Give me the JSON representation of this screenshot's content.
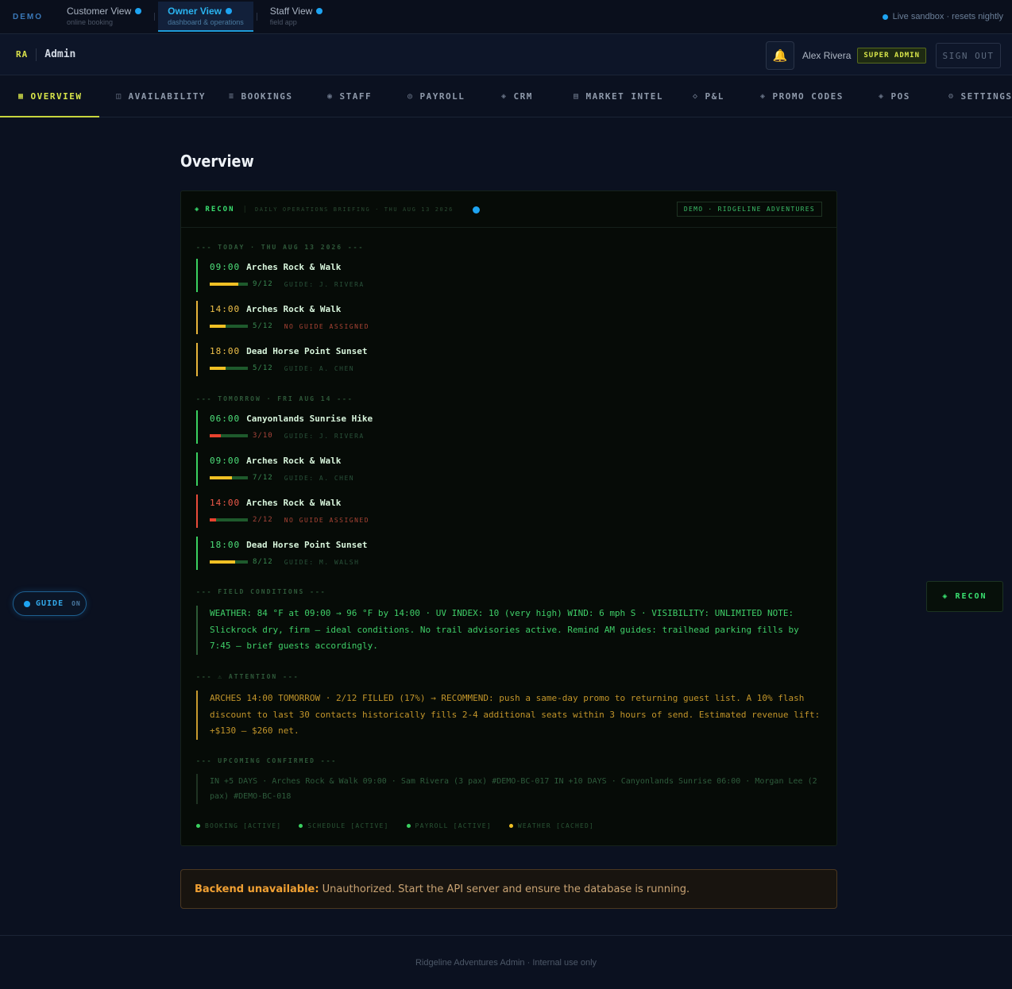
{
  "demo_bar": {
    "tag": "DEMO",
    "views": [
      {
        "title": "Customer View",
        "subtitle": "online booking"
      },
      {
        "title": "Owner View",
        "subtitle": "dashboard & operations"
      },
      {
        "title": "Staff View",
        "subtitle": "field app"
      }
    ],
    "live_status": "Live sandbox · resets nightly"
  },
  "header": {
    "initials": "RA",
    "section": "Admin",
    "bell_icon": "🔔",
    "user_name": "Alex Rivera",
    "role_badge": "SUPER ADMIN",
    "sign_out": "SIGN OUT"
  },
  "nav": [
    {
      "icon": "▦",
      "label": "OVERVIEW"
    },
    {
      "icon": "◫",
      "label": "AVAILABILITY"
    },
    {
      "icon": "≡",
      "label": "BOOKINGS"
    },
    {
      "icon": "◉",
      "label": "STAFF"
    },
    {
      "icon": "◎",
      "label": "PAYROLL"
    },
    {
      "icon": "◈",
      "label": "CRM"
    },
    {
      "icon": "▤",
      "label": "MARKET INTEL"
    },
    {
      "icon": "◇",
      "label": "P&L"
    },
    {
      "icon": "◈",
      "label": "PROMO CODES"
    },
    {
      "icon": "◈",
      "label": "POS"
    },
    {
      "icon": "⚙",
      "label": "SETTINGS"
    }
  ],
  "page_title": "Overview",
  "recon": {
    "icon": "◈",
    "title": "RECON",
    "separator": "|",
    "subtitle": "DAILY OPERATIONS BRIEFING · THU AUG 13 2026",
    "demo_badge": "DEMO · RIDGELINE ADVENTURES",
    "today_header": "--- TODAY · THU AUG 13 2026 ---",
    "today": [
      {
        "time": "09:00",
        "name": "Arches Rock & Walk",
        "capacity": "9/12",
        "fill": 0.75,
        "guide": "GUIDE: J. RIVERA",
        "status": "green"
      },
      {
        "time": "14:00",
        "name": "Arches Rock & Walk",
        "capacity": "5/12",
        "fill": 0.42,
        "guide": "NO GUIDE ASSIGNED",
        "status": "amber"
      },
      {
        "time": "18:00",
        "name": "Dead Horse Point Sunset",
        "capacity": "5/12",
        "fill": 0.42,
        "guide": "GUIDE: A. CHEN",
        "status": "amber"
      }
    ],
    "tomorrow_header": "--- TOMORROW · FRI AUG 14 ---",
    "tomorrow": [
      {
        "time": "06:00",
        "name": "Canyonlands Sunrise Hike",
        "capacity": "3/10",
        "fill": 0.3,
        "guide": "GUIDE: J. RIVERA",
        "status": "green"
      },
      {
        "time": "09:00",
        "name": "Arches Rock & Walk",
        "capacity": "7/12",
        "fill": 0.58,
        "guide": "GUIDE: A. CHEN",
        "status": "green"
      },
      {
        "time": "14:00",
        "name": "Arches Rock & Walk",
        "capacity": "2/12",
        "fill": 0.17,
        "guide": "NO GUIDE ASSIGNED",
        "status": "red"
      },
      {
        "time": "18:00",
        "name": "Dead Horse Point Sunset",
        "capacity": "8/12",
        "fill": 0.67,
        "guide": "GUIDE: M. WALSH",
        "status": "green"
      }
    ],
    "field_header": "--- FIELD CONDITIONS ---",
    "field_text": "WEATHER: 84 °F at 09:00 → 96 °F by 14:00 · UV INDEX: 10 (very high) WIND: 6 mph S · VISIBILITY: UNLIMITED NOTE: Slickrock dry, firm — ideal conditions. No trail advisories active. Remind AM guides: trailhead parking fills by 7:45 — brief guests accordingly.",
    "attention_header": "--- ⚠ ATTENTION ---",
    "attention_text": "ARCHES 14:00 TOMORROW · 2/12 FILLED (17%) → RECOMMEND: push a same-day promo to returning guest list. A 10% flash discount to last 30 contacts historically fills 2-4 additional seats within 3 hours of send. Estimated revenue lift: +$130 – $260 net.",
    "upcoming_header": "--- UPCOMING CONFIRMED ---",
    "upcoming_text": "IN +5 DAYS · Arches Rock & Walk 09:00 · Sam Rivera (3 pax) #DEMO-BC-017 IN +10 DAYS · Canyonlands Sunrise 06:00 · Morgan Lee (2 pax) #DEMO-BC-018",
    "systems": [
      {
        "label": "BOOKING [ACTIVE]",
        "color": "green"
      },
      {
        "label": "SCHEDULE [ACTIVE]",
        "color": "green"
      },
      {
        "label": "PAYROLL [ACTIVE]",
        "color": "green"
      },
      {
        "label": "WEATHER [CACHED]",
        "color": "yellow"
      }
    ]
  },
  "error": {
    "strong": "Backend unavailable:",
    "message": "Unauthorized. Start the API server and ensure the database is running."
  },
  "footer": "Ridgeline Adventures Admin · Internal use only",
  "guide_toggle": {
    "label": "GUIDE",
    "state": "ON"
  },
  "recon_fab": {
    "icon": "◈",
    "label": "RECON"
  },
  "colors": {
    "accent": "#d8e54a",
    "recon_green": "#3ae070",
    "info_blue": "#1ea4f2",
    "warning": "#f0a033"
  }
}
